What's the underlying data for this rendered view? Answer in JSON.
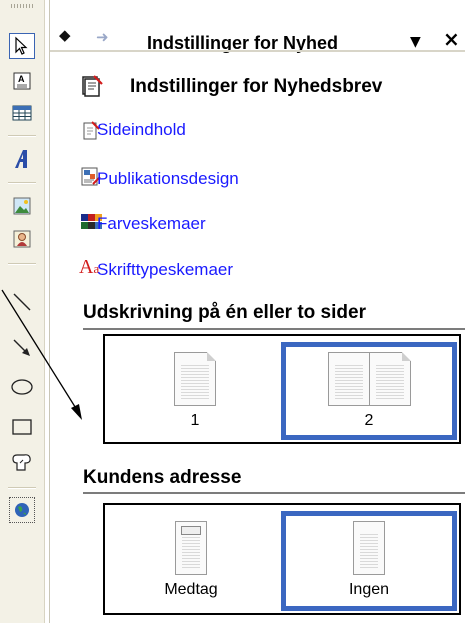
{
  "toolbar": {
    "tools": [
      {
        "name": "select-pointer-icon"
      },
      {
        "name": "text-box-icon"
      },
      {
        "name": "table-icon"
      },
      {
        "name": "wordart-icon"
      },
      {
        "name": "picture-icon"
      },
      {
        "name": "clipart-icon"
      },
      {
        "name": "line-icon"
      },
      {
        "name": "arrow-icon"
      },
      {
        "name": "oval-icon"
      },
      {
        "name": "rectangle-icon"
      },
      {
        "name": "autoshapes-icon"
      },
      {
        "name": "web-object-icon"
      }
    ]
  },
  "pane": {
    "title": "Indstillinger for Nyhed",
    "main_heading": "Indstillinger for Nyhedsbrev",
    "links": [
      {
        "label": "Sideindhold",
        "icon": "page-content-icon"
      },
      {
        "label": "Publikationsdesign",
        "icon": "publication-design-icon"
      },
      {
        "label": "Farveskemaer",
        "icon": "color-scheme-icon"
      },
      {
        "label": "Skrifttypeskemaer",
        "icon": "font-scheme-icon"
      }
    ],
    "print_group": {
      "heading": "Udskrivning på én eller to sider",
      "options": [
        {
          "label": "1",
          "selected": false
        },
        {
          "label": "2",
          "selected": true
        }
      ]
    },
    "address_group": {
      "heading": "Kundens adresse",
      "options": [
        {
          "label": "Medtag",
          "selected": false
        },
        {
          "label": "Ingen",
          "selected": true
        }
      ]
    }
  },
  "colors": {
    "link": "#1a1aff",
    "selection": "#3b67c1",
    "toolbar_bg": "#f3f1e6"
  }
}
